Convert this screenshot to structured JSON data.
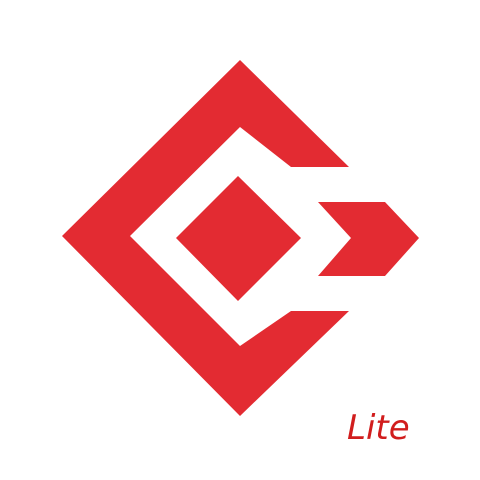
{
  "icon": {
    "name": "logo-icon",
    "brand_color": "#E32B32",
    "background": "#FFFFFF"
  },
  "edition": {
    "label": "Lite",
    "color": "#D11D1D"
  }
}
